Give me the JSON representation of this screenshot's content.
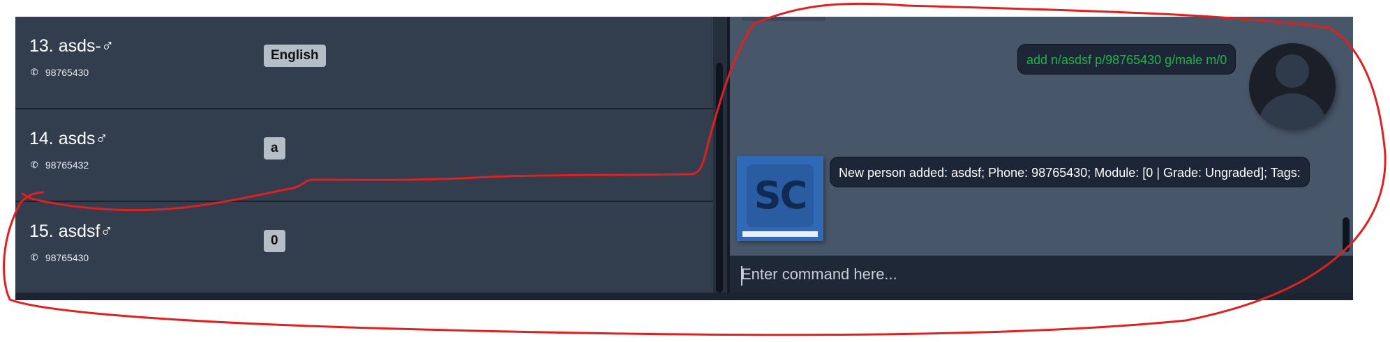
{
  "persons": [
    {
      "name": "13. asds-♂",
      "phone": "98765430",
      "tag": "English"
    },
    {
      "name": "14. asds♂",
      "phone": "98765432",
      "tag": "a"
    },
    {
      "name": "15. asdsf♂",
      "phone": "98765430",
      "tag": "0"
    }
  ],
  "icons": {
    "phone": "phone-icon",
    "user_avatar": "user-avatar-icon",
    "bot_logo": "sc-logo"
  },
  "bot_logo_text": "SC",
  "chat": {
    "user_message": "add n/asdsf p/98765430 g/male m/0",
    "bot_message": "New person added: asdsf; Phone: 98765430; Module: [0 | Grade: Ungraded]; Tags:"
  },
  "command_input": {
    "value": "",
    "placeholder": "Enter command here..."
  },
  "colors": {
    "list_bg": "#323d4e",
    "chat_bg": "#48566a",
    "user_text": "#25b04a",
    "tag_bg": "#b5bdc7",
    "annotation": "#e02020"
  }
}
